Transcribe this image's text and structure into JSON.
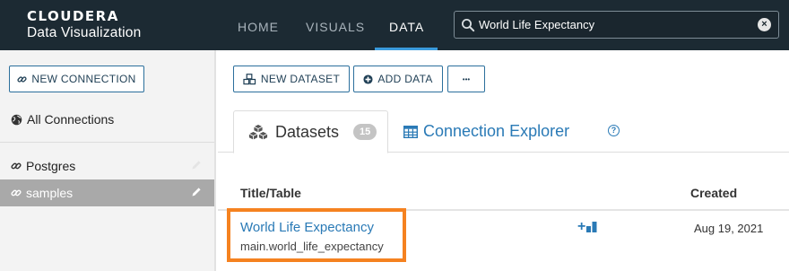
{
  "brand": {
    "company": "CLOUDERA",
    "product": "Data Visualization"
  },
  "nav": {
    "tabs": [
      {
        "label": "HOME"
      },
      {
        "label": "VISUALS"
      },
      {
        "label": "DATA"
      }
    ],
    "active": "DATA"
  },
  "search": {
    "value": "World Life Expectancy",
    "placeholder": "Search"
  },
  "sidebar": {
    "new_connection_label": "NEW CONNECTION",
    "all_connections_label": "All Connections",
    "connections": [
      {
        "label": "Postgres"
      },
      {
        "label": "samples",
        "selected": true
      }
    ]
  },
  "toolbar": {
    "new_dataset_label": "NEW DATASET",
    "add_data_label": "ADD DATA",
    "more_label": "•••"
  },
  "tabs": {
    "datasets_label": "Datasets",
    "datasets_count": "15",
    "explorer_label": "Connection Explorer",
    "help_label": "?"
  },
  "table": {
    "headers": {
      "title": "Title/Table",
      "created": "Created"
    },
    "rows": [
      {
        "title": "World Life Expectancy",
        "table": "main.world_life_expectancy",
        "created": "Aug 19, 2021",
        "new_visual_label": "+"
      }
    ]
  },
  "colors": {
    "nav_bg": "#1c2a33",
    "accent": "#2a7ab6",
    "highlight": "#f58220",
    "nav_underline": "#3a9bdc"
  }
}
